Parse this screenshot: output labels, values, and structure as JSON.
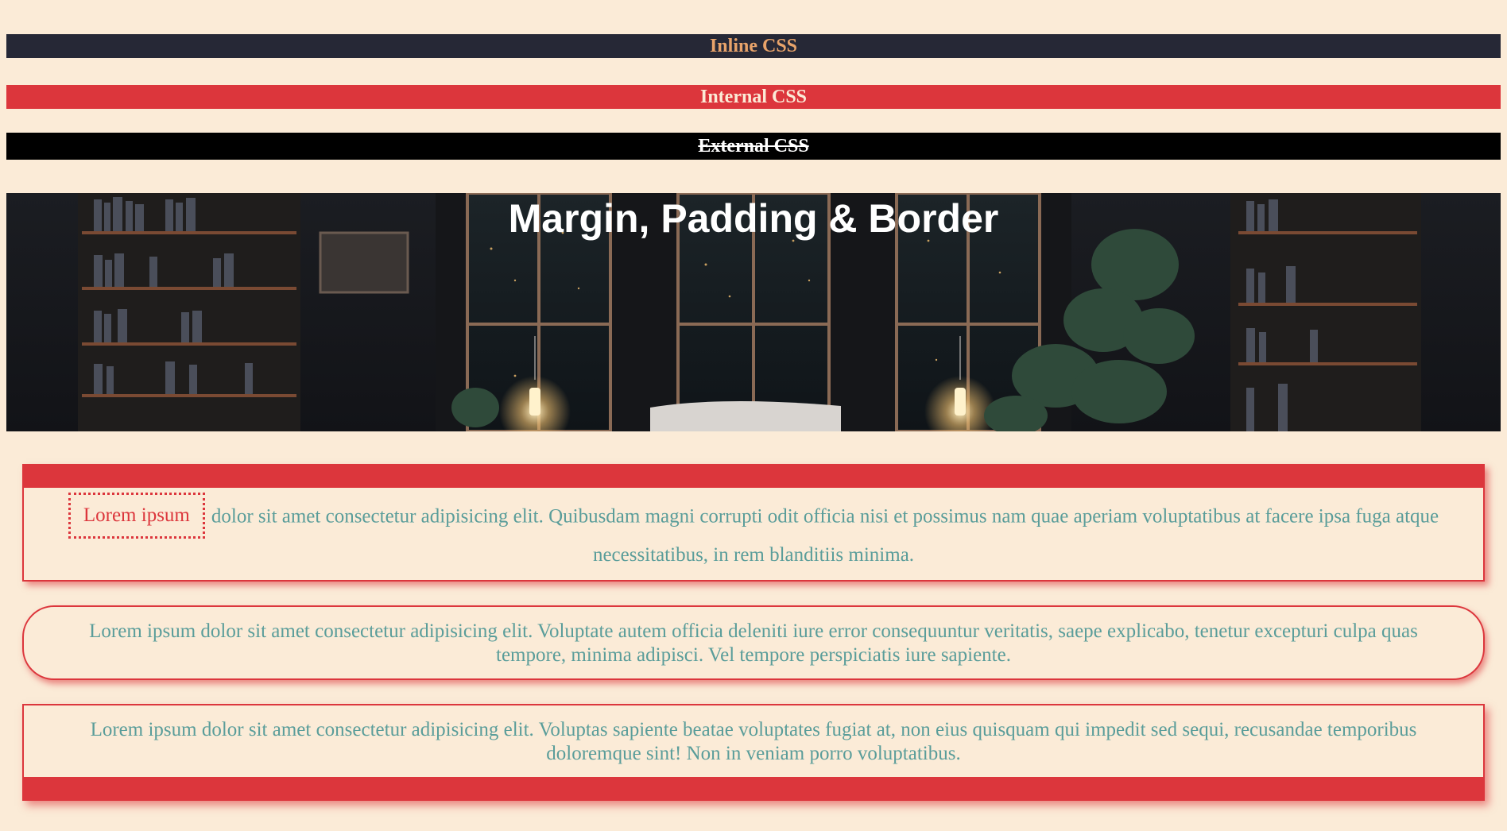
{
  "headings": {
    "inline": "Inline CSS",
    "internal": "Internal CSS",
    "external": "External CSS"
  },
  "hero": {
    "title": "Margin, Padding & Border"
  },
  "paragraphs": {
    "p1_badge": "Lorem ipsum",
    "p1_text": "dolor sit amet consectetur adipisicing elit. Quibusdam magni corrupti odit officia nisi et possimus nam quae aperiam voluptatibus at facere ipsa fuga atque necessitatibus, in rem blanditiis minima.",
    "p2_text": "Lorem ipsum dolor sit amet consectetur adipisicing elit. Voluptate autem officia deleniti iure error consequuntur veritatis, saepe explicabo, tenetur excepturi culpa quas tempore, minima adipisci. Vel tempore perspiciatis iure sapiente.",
    "p3_text": "Lorem ipsum dolor sit amet consectetur adipisicing elit. Voluptas sapiente beatae voluptates fugiat at, non eius quisquam qui impedit sed sequi, recusandae temporibus doloremque sint! Non in veniam porro voluptatibus."
  },
  "colors": {
    "page_background": "#fbebd7",
    "inline_bar": "#262836",
    "inline_text": "#e8a36a",
    "accent_red": "#dc363c",
    "body_text": "#5a9d9a",
    "external_bar": "#000000"
  }
}
